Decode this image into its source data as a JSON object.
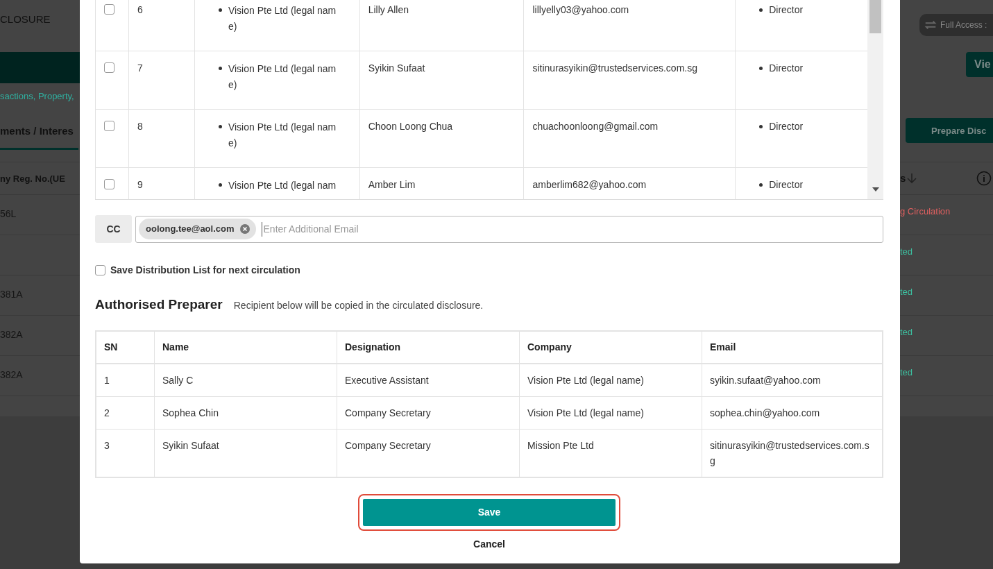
{
  "background_page": {
    "header_title": "CLOSURE",
    "access_badge": "Full Access :",
    "view_button": "Vie",
    "subtitle": "sactions, Property,",
    "active_tab": "ments / Interes",
    "prepare_button": "Prepare Disc",
    "table": {
      "column_1": "ny Reg. No.(UE",
      "column_2": "s",
      "rows": [
        {
          "column_1": "56L",
          "column_2": "g Circulation",
          "color": "#e06060"
        },
        {
          "column_1": "",
          "column_2": "ted",
          "color": "#3cc0a0"
        },
        {
          "column_1": "381A",
          "column_2": "ted",
          "color": "#3cc0a0"
        },
        {
          "column_1": "382A",
          "column_2": "ted",
          "color": "#3cc0a0"
        },
        {
          "column_1": "382A",
          "column_2": "ted",
          "color": "#3cc0a0"
        }
      ]
    }
  },
  "dialog": {
    "recipients": [
      {
        "checked": false,
        "sn": "6",
        "company": "Vision Pte Ltd (legal name)",
        "name": "Lilly Allen",
        "email": "lillyelly03@yahoo.com",
        "role": "Director"
      },
      {
        "checked": false,
        "sn": "7",
        "company": "Vision Pte Ltd (legal name)",
        "name": "Syikin Sufaat",
        "email": "sitinurasyikin@trustedservices.com.sg",
        "role": "Director"
      },
      {
        "checked": false,
        "sn": "8",
        "company": "Vision Pte Ltd (legal name)",
        "name": "Choon Loong Chua",
        "email": "chuachoonloong@gmail.com",
        "role": "Director"
      },
      {
        "checked": false,
        "sn": "9",
        "company": "Vision Pte Ltd (legal nam",
        "name": "Amber Lim",
        "email": "amberlim682@yahoo.com",
        "role": "Director"
      }
    ],
    "cc": {
      "label": "CC",
      "chips": [
        "oolong.tee@aol.com"
      ],
      "placeholder": "Enter Additional Email"
    },
    "save_list": {
      "label": "Save Distribution List for next circulation",
      "checked": false
    },
    "preparer": {
      "title": "Authorised Preparer",
      "note": "Recipient below will be copied in the circulated disclosure.",
      "columns": [
        "SN",
        "Name",
        "Designation",
        "Company",
        "Email"
      ],
      "rows": [
        [
          "1",
          "Sally C",
          "Executive Assistant",
          "Vision Pte Ltd (legal name)",
          "syikin.sufaat@yahoo.com"
        ],
        [
          "2",
          "Sophea Chin",
          "Company Secretary",
          "Vision Pte Ltd (legal name)",
          "sophea.chin@yahoo.com"
        ],
        [
          "3",
          "Syikin Sufaat",
          "Company Secretary",
          "Mission Pte Ltd",
          "sitinurasyikin@trustedservices.com.sg"
        ]
      ]
    },
    "buttons": {
      "save": "Save",
      "cancel": "Cancel"
    }
  }
}
